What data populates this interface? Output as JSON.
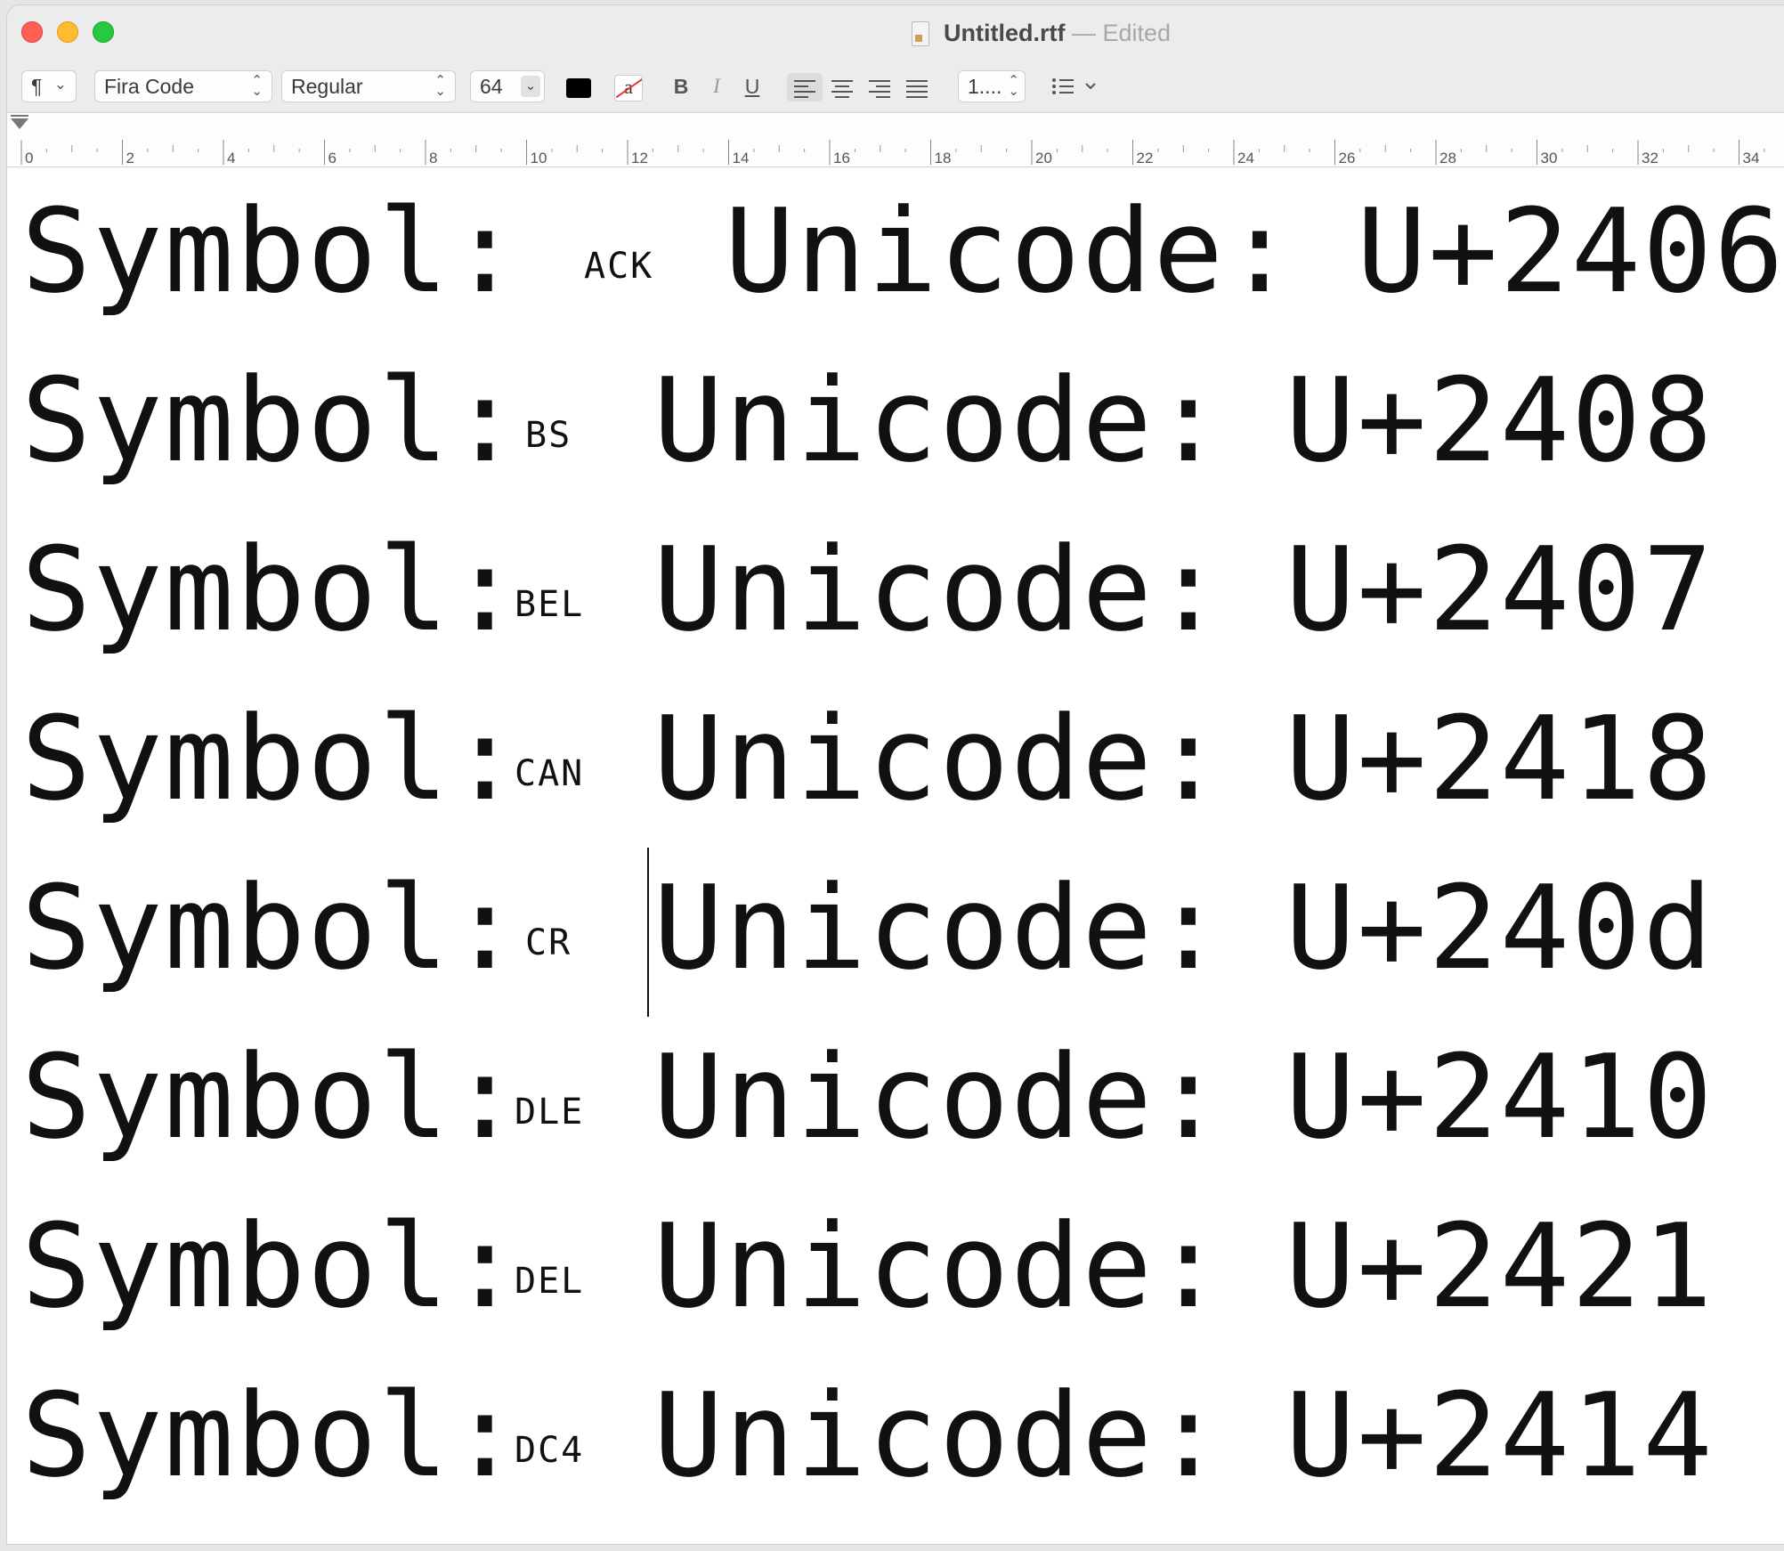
{
  "window": {
    "title": "Untitled.rtf",
    "title_separator": "—",
    "status": "Edited"
  },
  "toolbar": {
    "paragraph_style_icon": "¶",
    "font_family": "Fira Code",
    "font_style": "Regular",
    "font_size": "64",
    "text_color": "#000000",
    "bold_label": "B",
    "italic_label": "I",
    "underline_label": "U",
    "strike_label": "a",
    "line_spacing": "1....",
    "list_icon": "list-icon"
  },
  "ruler": {
    "ticks": [
      "0",
      "2",
      "4",
      "6",
      "8",
      "10",
      "12",
      "14",
      "16",
      "18",
      "20",
      "22",
      "24",
      "26",
      "28",
      "30",
      "32",
      "34"
    ]
  },
  "document": {
    "lines": [
      {
        "prefix": "Symbol:",
        "symbol": "ACK",
        "label": "Unicode:",
        "code": "U+2406"
      },
      {
        "prefix": "Symbol:",
        "symbol": "BS",
        "label": "Unicode:",
        "code": "U+2408"
      },
      {
        "prefix": "Symbol:",
        "symbol": "BEL",
        "label": "Unicode:",
        "code": "U+2407"
      },
      {
        "prefix": "Symbol:",
        "symbol": "CAN",
        "label": "Unicode:",
        "code": "U+2418"
      },
      {
        "prefix": "Symbol:",
        "symbol": "CR",
        "label": "Unicode:",
        "code": "U+240d"
      },
      {
        "prefix": "Symbol:",
        "symbol": "DLE",
        "label": "Unicode:",
        "code": "U+2410"
      },
      {
        "prefix": "Symbol:",
        "symbol": "DEL",
        "label": "Unicode:",
        "code": "U+2421"
      },
      {
        "prefix": "Symbol:",
        "symbol": "DC4",
        "label": "Unicode:",
        "code": "U+2414"
      }
    ]
  }
}
